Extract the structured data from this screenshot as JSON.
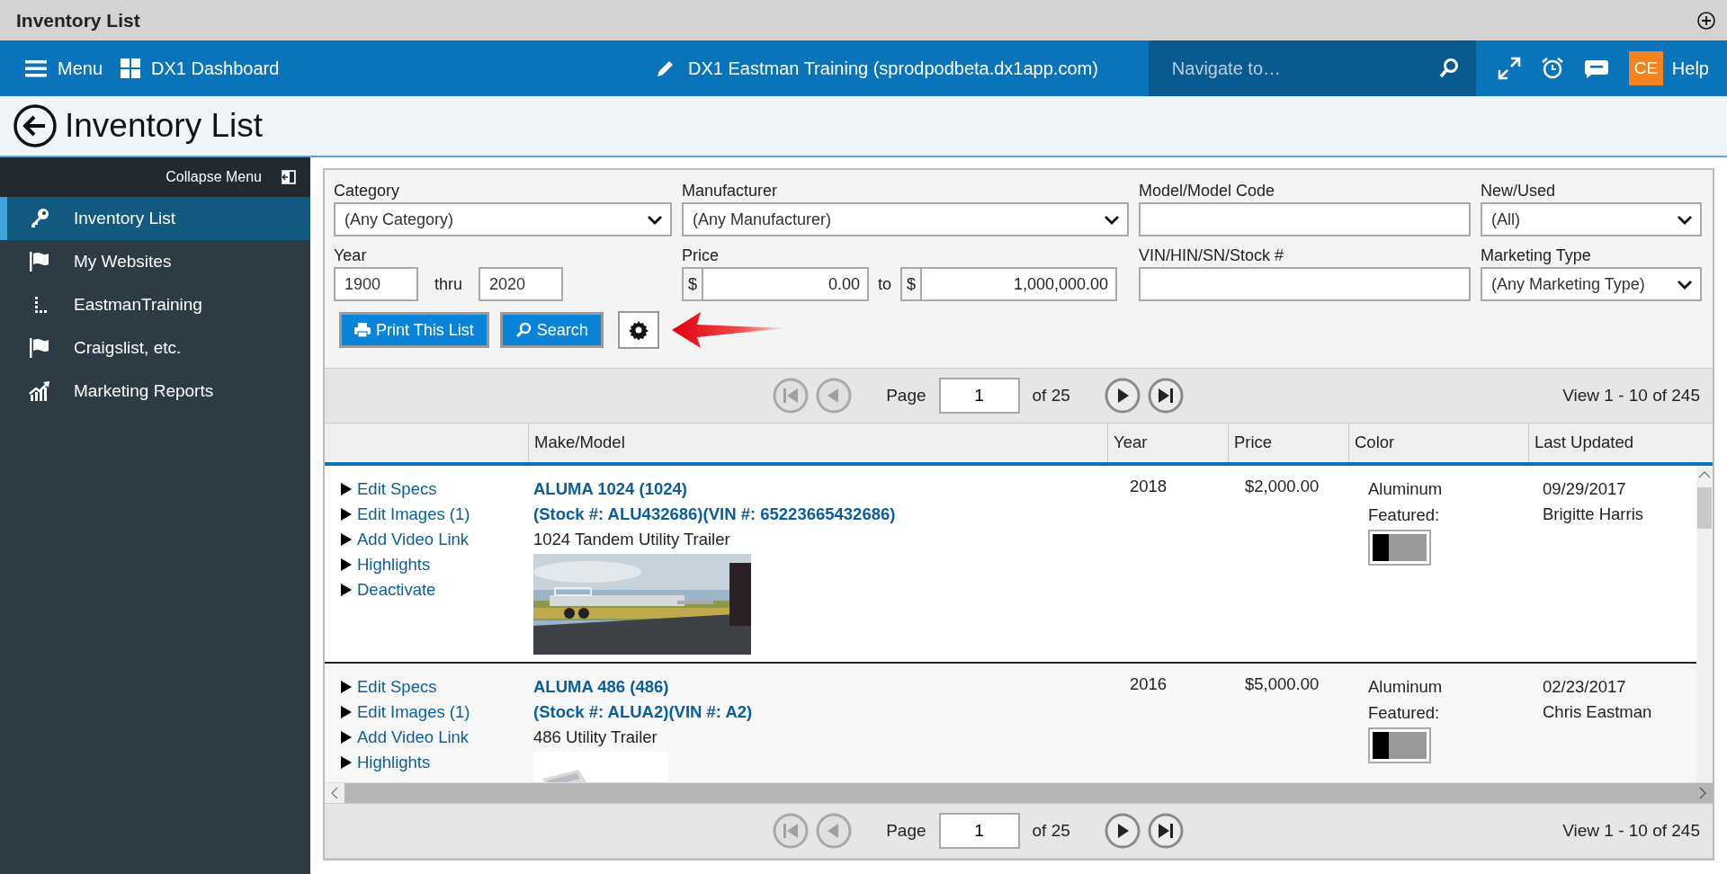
{
  "title_bar": {
    "title": "Inventory List"
  },
  "nav": {
    "menu": "Menu",
    "dashboard": "DX1 Dashboard",
    "site": "DX1 Eastman Training (sprodpodbeta.dx1app.com)",
    "search": {
      "placeholder": "Navigate to…"
    },
    "avatar": "CE",
    "help": "Help"
  },
  "page_header": {
    "title": "Inventory List"
  },
  "sidebar": {
    "collapse": "Collapse Menu",
    "items": [
      {
        "label": "Inventory List",
        "selected": true
      },
      {
        "label": "My Websites",
        "selected": false
      },
      {
        "label": "EastmanTraining",
        "selected": false
      },
      {
        "label": "Craigslist, etc.",
        "selected": false
      },
      {
        "label": "Marketing Reports",
        "selected": false
      }
    ]
  },
  "filters": {
    "category": {
      "label": "Category",
      "value": "(Any Category)"
    },
    "manufacturer": {
      "label": "Manufacturer",
      "value": "(Any Manufacturer)"
    },
    "model": {
      "label": "Model/Model Code"
    },
    "new_used": {
      "label": "New/Used",
      "value": "(All)"
    },
    "year": {
      "label": "Year",
      "from": "1900",
      "separator": "thru",
      "to": "2020"
    },
    "price": {
      "label": "Price",
      "from_currency": "$",
      "from": "0.00",
      "separator": "to",
      "to_currency": "$",
      "to": "1,000,000.00"
    },
    "vin": {
      "label": "VIN/HIN/SN/Stock #"
    },
    "marketing_type": {
      "label": "Marketing Type",
      "value": "(Any Marketing Type)"
    },
    "buttons": [
      {
        "label": "Print This List",
        "kind": "print"
      },
      {
        "label": "Search",
        "kind": "search"
      }
    ]
  },
  "pager_top": {
    "page_label": "Page",
    "page": "1",
    "of": "of 25",
    "view": "View 1 - 10 of 245",
    "buttons": [
      {
        "kind": "first",
        "disabled": true
      },
      {
        "kind": "prev",
        "disabled": true
      },
      {
        "kind": "next",
        "disabled": false
      },
      {
        "kind": "last",
        "disabled": false
      }
    ]
  },
  "table": {
    "columns": [
      "Make/Model",
      "Year",
      "Price",
      "Color",
      "Last Updated"
    ],
    "rows": [
      {
        "actions": [
          "Edit Specs",
          "Edit Images (1)",
          "Add Video Link",
          "Highlights",
          "Deactivate"
        ],
        "title": "ALUMA 1024 (1024)",
        "stock": "(Stock #: ALU432686)(VIN #: 65223665432686)",
        "description": "1024 Tandem Utility Trailer",
        "year": "2018",
        "price": "$2,000.00",
        "color_name": "Aluminum",
        "featured_label": "Featured:",
        "featured": false,
        "updated": "09/29/2017",
        "updated_by": "Brigitte Harris"
      },
      {
        "actions": [
          "Edit Specs",
          "Edit Images (1)",
          "Add Video Link",
          "Highlights"
        ],
        "title": "ALUMA 486 (486)",
        "stock": "(Stock #: ALUA2)(VIN #: A2)",
        "description": "486 Utility Trailer",
        "year": "2016",
        "price": "$5,000.00",
        "color_name": "Aluminum",
        "featured_label": "Featured:",
        "featured": false,
        "updated": "02/23/2017",
        "updated_by": "Chris Eastman"
      }
    ]
  },
  "pager_bottom": {
    "page_label": "Page",
    "page": "1",
    "of": "of 25",
    "view": "View 1 - 10 of 245",
    "buttons": [
      {
        "kind": "first",
        "disabled": true
      },
      {
        "kind": "prev",
        "disabled": true
      },
      {
        "kind": "next",
        "disabled": false
      },
      {
        "kind": "last",
        "disabled": false
      }
    ]
  }
}
